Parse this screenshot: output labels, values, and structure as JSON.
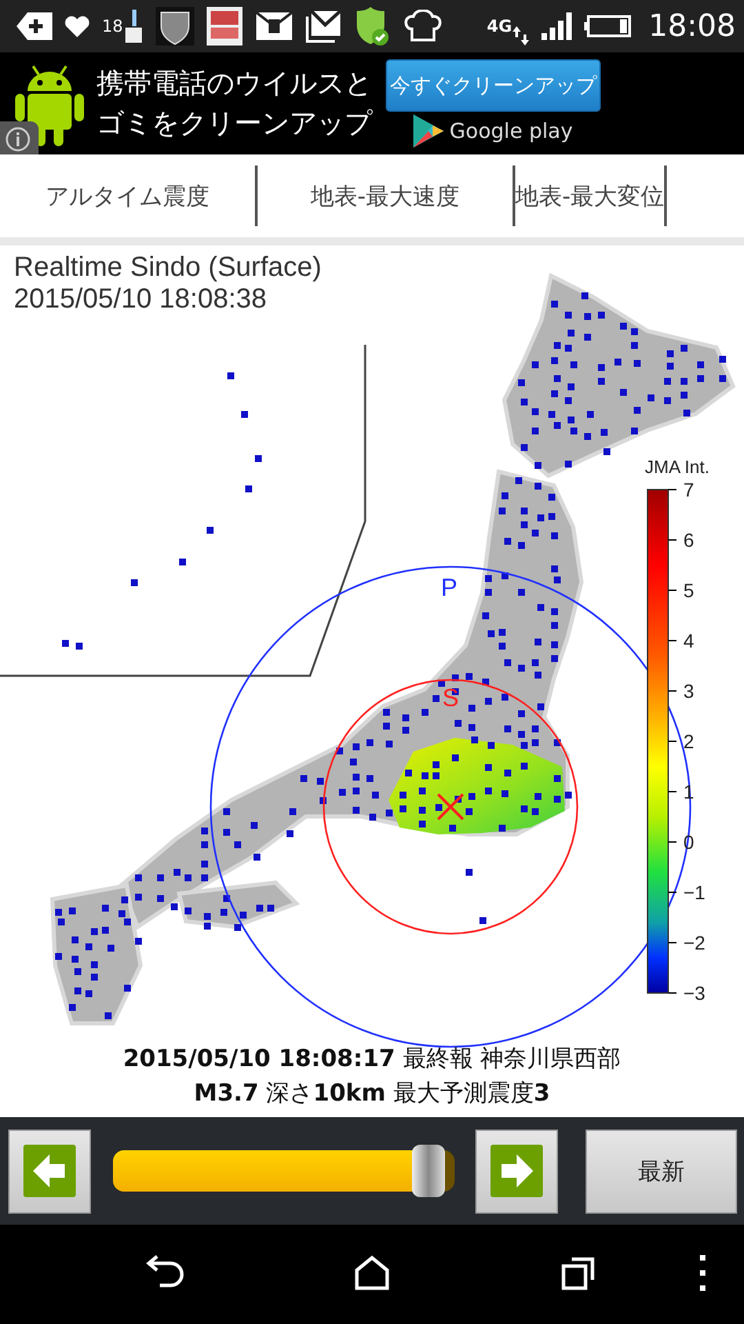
{
  "status_bar": {
    "badge": "18",
    "network": "4G",
    "time": "18:08"
  },
  "ad": {
    "lines": [
      "携帯電話のウイルスと",
      "ゴミをクリーンアップ"
    ],
    "button": "今すぐクリーンアップ",
    "store": "Google play"
  },
  "tabs": [
    {
      "label": "アルタイム震度"
    },
    {
      "label": "地表-最大速度"
    },
    {
      "label": "地表-最大変位"
    }
  ],
  "map": {
    "title": "Realtime Sindo (Surface)",
    "timestamp": "2015/05/10 18:08:38",
    "p_label": "P",
    "s_label": "S",
    "legend": {
      "title": "JMA Int.",
      "ticks": [
        "7",
        "6",
        "5",
        "4",
        "3",
        "2",
        "1",
        "0",
        "−1",
        "−2",
        "−3"
      ]
    },
    "caption": [
      "**2015/05/10 18:08:17** 最終報 神奈川県西部",
      "**M3.7** 深さ**10km** 最大予測震度**3**"
    ]
  },
  "controls": {
    "slider": {
      "level": 0.97
    },
    "latest_button": "最新"
  }
}
